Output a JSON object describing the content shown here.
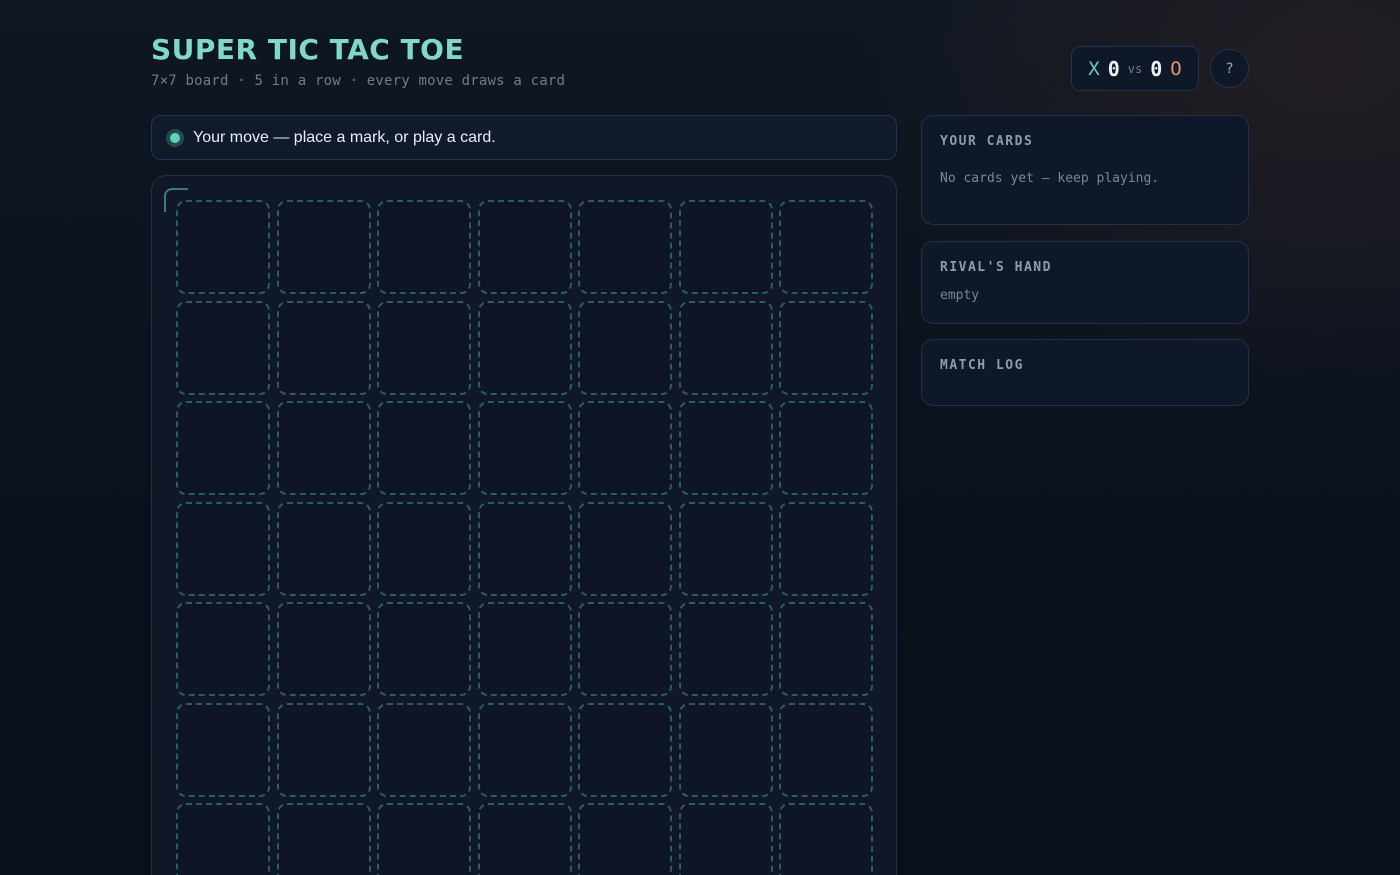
{
  "header": {
    "title": "SUPER TIC TAC TOE",
    "subtitle": "7×7 board · 5 in a row · every move draws a card"
  },
  "score": {
    "x_label": "X",
    "x_score": "0",
    "vs": "vs",
    "o_score": "0",
    "o_label": "O"
  },
  "help_label": "?",
  "status": {
    "text": "Your move — place a mark, or play a card."
  },
  "board": {
    "rows": 7,
    "cols": 7,
    "cells": [
      [
        "",
        "",
        "",
        "",
        "",
        "",
        ""
      ],
      [
        "",
        "",
        "",
        "",
        "",
        "",
        ""
      ],
      [
        "",
        "",
        "",
        "",
        "",
        "",
        ""
      ],
      [
        "",
        "",
        "",
        "",
        "",
        "",
        ""
      ],
      [
        "",
        "",
        "",
        "",
        "",
        "",
        ""
      ],
      [
        "",
        "",
        "",
        "",
        "",
        "",
        ""
      ],
      [
        "",
        "",
        "",
        "",
        "",
        "",
        ""
      ]
    ]
  },
  "panels": {
    "your_cards": {
      "title": "YOUR CARDS",
      "text": "No cards yet — keep playing."
    },
    "rivals_hand": {
      "title": "RIVAL'S HAND",
      "text": "empty"
    },
    "match_log": {
      "title": "MATCH LOG",
      "entries": []
    }
  },
  "colors": {
    "accent": "#7fd8c8",
    "x_color": "#6cc9b8",
    "o_color": "#e7907a",
    "cell_border": "#2c5a66"
  }
}
